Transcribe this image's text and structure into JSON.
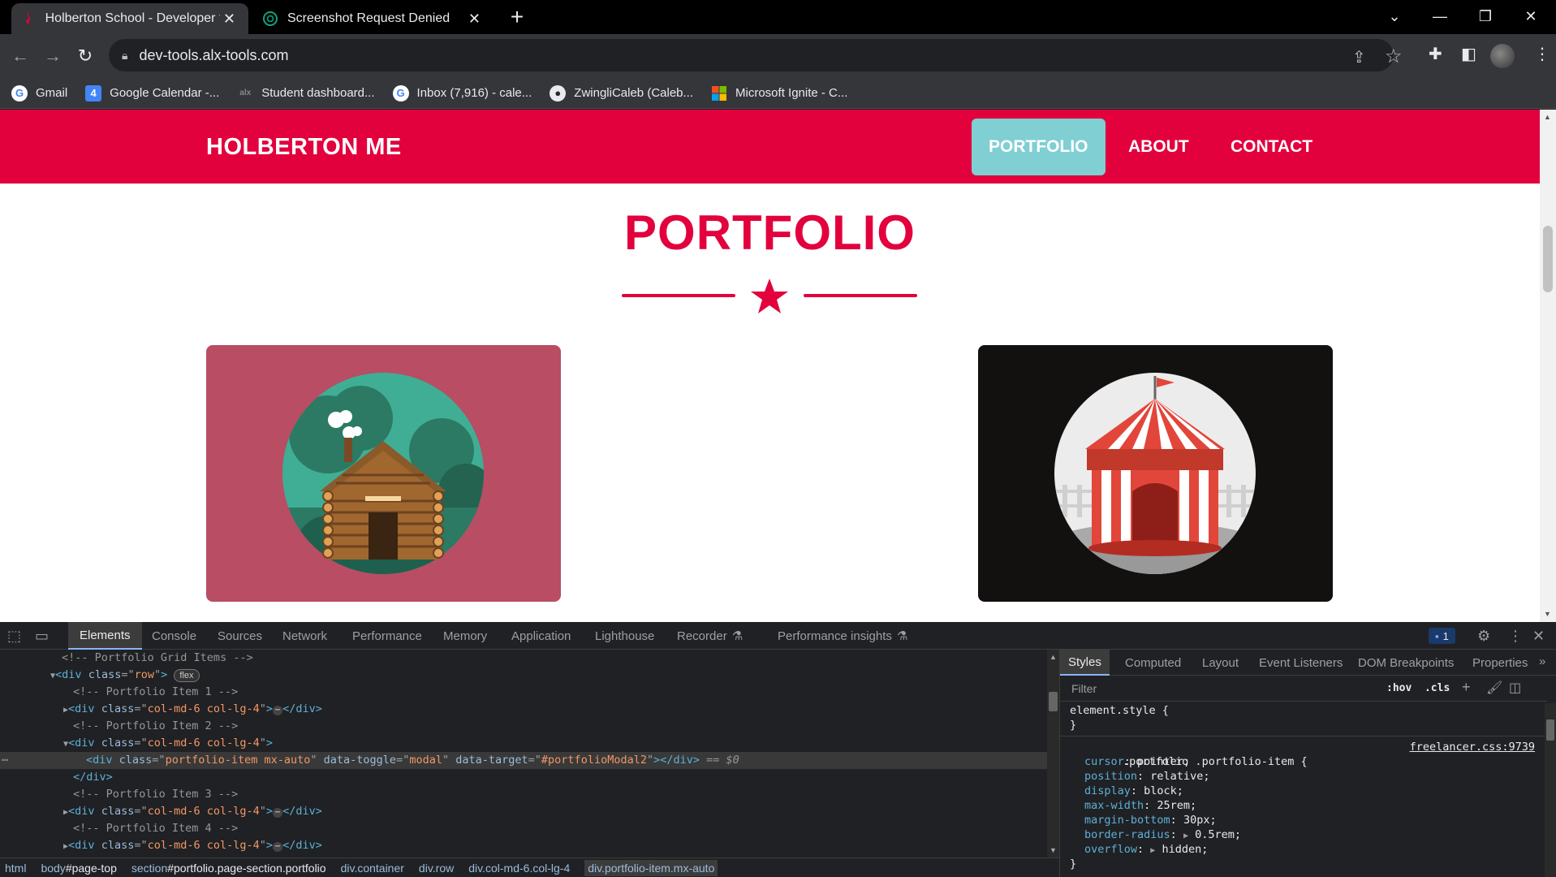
{
  "tabs": [
    {
      "title": "Holberton School - Developer tools",
      "active": true
    },
    {
      "title": "Screenshot Request Denied",
      "active": false
    }
  ],
  "address": {
    "url": "dev-tools.alx-tools.com"
  },
  "bookmarks": [
    {
      "label": "Gmail",
      "icon": "google-icon"
    },
    {
      "label": "Google Calendar -...",
      "icon": "calendar-icon",
      "badge": "4"
    },
    {
      "label": "Student dashboard...",
      "icon": "alx-icon",
      "badge": "alx"
    },
    {
      "label": "Inbox (7,916) - cale...",
      "icon": "google-icon"
    },
    {
      "label": "ZwingliCaleb (Caleb...",
      "icon": "github-icon"
    },
    {
      "label": "Microsoft Ignite - C...",
      "icon": "microsoft-icon"
    }
  ],
  "site": {
    "brand": "HOLBERTON ME",
    "nav": [
      {
        "label": "PORTFOLIO",
        "active": true
      },
      {
        "label": "ABOUT",
        "active": false
      },
      {
        "label": "CONTACT",
        "active": false
      }
    ],
    "section_title": "PORTFOLIO",
    "accent": "#e2003d",
    "active_nav_color": "#7fcfd3",
    "portfolio_items": [
      {
        "name": "cabin",
        "bg": "#b84d64"
      },
      {
        "name": "circus-tent",
        "bg": "#131010"
      }
    ]
  },
  "devtools": {
    "tabs": [
      "Elements",
      "Console",
      "Sources",
      "Network",
      "Performance",
      "Memory",
      "Application",
      "Lighthouse",
      "Recorder",
      "Performance insights"
    ],
    "active_tab": "Elements",
    "issues_count": "1",
    "elements": [
      {
        "text": "<!-- Portfolio Grid Items -->",
        "kind": "comment"
      },
      {
        "tag": "div",
        "attr": "class",
        "val": "row",
        "pill": "flex",
        "open": true
      },
      {
        "text": "<!-- Portfolio Item 1 -->",
        "kind": "comment"
      },
      {
        "tag": "div",
        "attr": "class",
        "val": "col-md-6 col-lg-4",
        "collapsed": true
      },
      {
        "text": "<!-- Portfolio Item 2 -->",
        "kind": "comment"
      },
      {
        "tag": "div",
        "attr": "class",
        "val": "col-md-6 col-lg-4",
        "open": true
      },
      {
        "tag": "div",
        "attr": "class",
        "val": "portfolio-item mx-auto",
        "attr2": "data-toggle",
        "val2": "modal",
        "attr3": "data-target",
        "val3": "#portfolioModal2",
        "selected": true,
        "marker": "== $0"
      },
      {
        "text": "</div>",
        "kind": "close"
      },
      {
        "text": "<!-- Portfolio Item 3 -->",
        "kind": "comment"
      },
      {
        "tag": "div",
        "attr": "class",
        "val": "col-md-6 col-lg-4",
        "collapsed": true
      },
      {
        "text": "<!-- Portfolio Item 4 -->",
        "kind": "comment"
      },
      {
        "tag": "div",
        "attr": "class",
        "val": "col-md-6 col-lg-4",
        "collapsed": true
      }
    ],
    "breadcrumbs": [
      {
        "tag": "html",
        "rest": ""
      },
      {
        "tag": "body",
        "rest": "#page-top"
      },
      {
        "tag": "section",
        "rest": "#portfolio.page-section.portfolio"
      },
      {
        "tag": "div",
        "rest": ".container"
      },
      {
        "tag": "div",
        "rest": ".row"
      },
      {
        "tag": "div",
        "rest": ".col-md-6.col-lg-4"
      },
      {
        "tag": "div",
        "rest": ".portfolio-item.mx-auto"
      }
    ],
    "styles_tabs": [
      "Styles",
      "Computed",
      "Layout",
      "Event Listeners",
      "DOM Breakpoints",
      "Properties"
    ],
    "filter_placeholder": "Filter",
    "hov": ":hov",
    "cls": ".cls",
    "element_style": "element.style {",
    "rule_selector": ".portfolio .portfolio-item {",
    "rule_source": "freelancer.css:9739",
    "declarations": [
      {
        "prop": "cursor",
        "value": "pointer;"
      },
      {
        "prop": "position",
        "value": "relative;"
      },
      {
        "prop": "display",
        "value": "block;"
      },
      {
        "prop": "max-width",
        "value": "25rem;"
      },
      {
        "prop": "margin-bottom",
        "value": "30px;"
      },
      {
        "prop": "border-radius",
        "value": "0.5rem;",
        "expandable": true
      },
      {
        "prop": "overflow",
        "value": "hidden;",
        "expandable": true
      }
    ]
  }
}
